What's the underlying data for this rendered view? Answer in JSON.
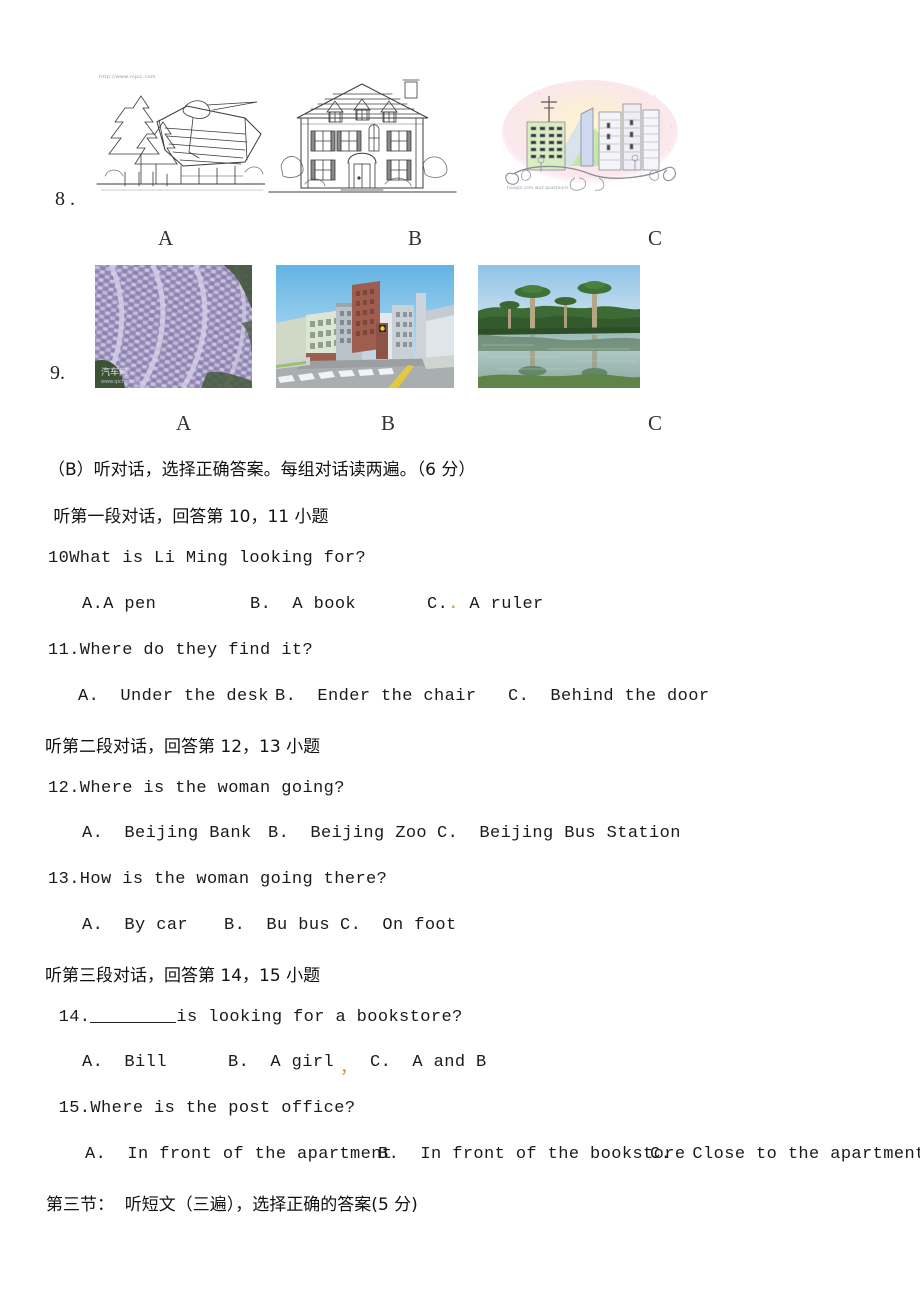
{
  "document": {
    "type": "english-listening-exam-paper",
    "language": "zh-CN/en"
  },
  "picture_questions": [
    {
      "number": "8",
      "number_text": "8  .",
      "options": [
        "A",
        "B",
        "C"
      ],
      "images": [
        {
          "label": "A",
          "alt": "line drawing of a thatched cottage among pine trees",
          "watermark": "http://www.nipic.com"
        },
        {
          "label": "B",
          "alt": "line drawing of a two-storey colonial house"
        },
        {
          "label": "C",
          "alt": "pastel illustration of a city skyline with tall buildings",
          "caption": "hoopje.com word question.com"
        }
      ]
    },
    {
      "number": "9",
      "number_text": "9.",
      "options": [
        "A",
        "B",
        "C"
      ],
      "images": [
        {
          "label": "A",
          "alt": "aerial photo of a huge parking lot full of cars",
          "watermark": "汽车网"
        },
        {
          "label": "B",
          "alt": "illustration of a city street with crosswalk and high rise buildings"
        },
        {
          "label": "C",
          "alt": "photo of baobab trees reflected in a lake"
        }
      ]
    }
  ],
  "section_b": {
    "heading": "（B）听对话，选择正确答案。每组对话读两遍。（6 分）",
    "groups": [
      {
        "instruction": " 听第一段对话，回答第 10，11 小题",
        "questions": [
          {
            "stem": "10What is Li Ming looking for?",
            "choices": [
              {
                "text": "A.A pen"
              },
              {
                "text": "B.  A book"
              },
              {
                "text": "C.",
                "orange_mark": ".",
                "text_after": " A ruler"
              }
            ]
          },
          {
            "stem": "11.Where do they find it?",
            "choices": [
              {
                "text": "A.  Under the desk"
              },
              {
                "text": "B.  Ender the chair"
              },
              {
                "text": "C.  Behind the door"
              }
            ]
          }
        ]
      },
      {
        "instruction": "听第二段对话，回答第 12，13 小题",
        "questions": [
          {
            "stem": "12.Where is the woman going?",
            "choices": [
              {
                "text": "A.  Beijing Bank"
              },
              {
                "text": "B.  Beijing Zoo"
              },
              {
                "text": "C.  Beijing Bus Station"
              }
            ]
          },
          {
            "stem": "13.How is the woman going there?",
            "choices": [
              {
                "text": "A.  By car"
              },
              {
                "text": "B.  Bu bus"
              },
              {
                "text": "C.  On foot"
              }
            ]
          }
        ]
      },
      {
        "instruction": "听第三段对话，回答第 14，15 小题",
        "questions": [
          {
            "stem_prefix": " 14.",
            "stem_blank": true,
            "stem_suffix": "is looking for a bookstore?",
            "choices": [
              {
                "text": "A.  Bill"
              },
              {
                "text": "B.  A girl"
              },
              {
                "text": "orange_comma",
                "orange_mark": "，"
              },
              {
                "text": "C.  A and B"
              }
            ]
          },
          {
            "stem": " 15.Where is the post office?",
            "choices": [
              {
                "text": "A.  In front of the apartment"
              },
              {
                "text": "B.  In front of the bookstore"
              },
              {
                "text": "C.  Close to the apartment"
              }
            ]
          }
        ]
      }
    ]
  },
  "section_three": {
    "heading": "第三节：  听短文（三遍），选择正确的答案(5 分)"
  },
  "text_lines": {
    "q8_num": "8  .",
    "q9_num": "9.",
    "row8_a": "A",
    "row8_b": "B",
    "row8_c": "C",
    "row9_a": "A",
    "row9_b": "B",
    "row9_c": "C",
    "sec_b_heading": "（B）听对话，选择正确答案。每组对话读两遍。（6 分）",
    "g1_instruction": " 听第一段对话，回答第 10，11 小题",
    "q10_stem": "10What is Li Ming looking for?",
    "q10_a": "A.A pen",
    "q10_b": "B.  A book",
    "q10_c1": "C.",
    "q10_c_orange": ".",
    "q10_c2": " A ruler",
    "q11_stem": "11.Where do they find it?",
    "q11_a": "A.  Under the desk",
    "q11_b": "B.  Ender the chair",
    "q11_c": "C.  Behind the door",
    "g2_instruction": "听第二段对话，回答第 12，13 小题",
    "q12_stem": "12.Where is the woman going?",
    "q12_a": "A.  Beijing Bank",
    "q12_b": "B.  Beijing Zoo",
    "q12_c": "C.  Beijing Bus Station",
    "q13_stem": "13.How is the woman going there?",
    "q13_a": "A.  By car",
    "q13_b": "B.  Bu bus",
    "q13_c": "C.  On foot",
    "g3_instruction": "听第三段对话，回答第 14，15 小题",
    "q14_prefix": " 14.",
    "q14_suffix": "is looking for a bookstore?",
    "q14_a": "A.  Bill",
    "q14_b": "B.  A girl",
    "q14_orange_comma": "，",
    "q14_c": "C.  A and B",
    "q15_stem": " 15.Where is the post office?",
    "q15_a": "A.  In front of the apartment",
    "q15_b": "B.  In front of the bookstore",
    "q15_c": "C.  Close to the apartment",
    "sec3_heading": "第三节：  听短文（三遍），选择正确的答案(5 分)",
    "img8a_watermark": "http://www.nipic.com",
    "img8c_caption": "hoopje.com wuz quastouris",
    "img9a_watermark": "汽车网"
  },
  "colors": {
    "text": "#1a1a1a",
    "orange_mark": "#d99100",
    "page_background": "#ffffff"
  }
}
